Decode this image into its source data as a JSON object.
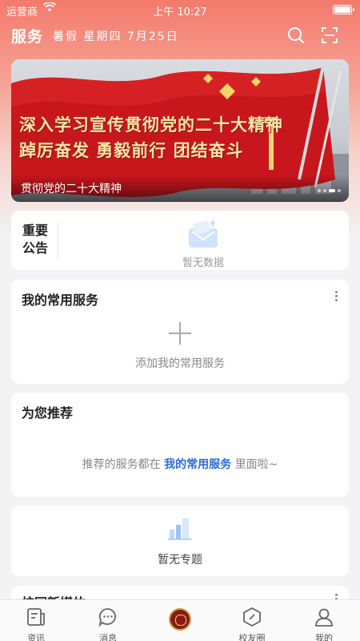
{
  "status_bar": {
    "carrier": "运营商",
    "time": "上午 10:27"
  },
  "header": {
    "title": "服务",
    "date": "暑假 星期四 7月25日"
  },
  "banner": {
    "headline_line1": "深入学习宣传贯彻党的二十大精神",
    "headline_line2": "踔厉奋发 勇毅前行 团结奋斗",
    "caption": "贯彻党的二十大精神"
  },
  "notice": {
    "label": "重要公告",
    "empty_text": "暂无数据"
  },
  "services": {
    "title": "我的常用服务",
    "add_text": "添加我的常用服务"
  },
  "recommend": {
    "title": "为您推荐",
    "hint_prefix": "推荐的服务都在 ",
    "hint_link": "我的常用服务",
    "hint_suffix": " 里面啦~"
  },
  "topics": {
    "empty_text": "暂无专题"
  },
  "next_section": {
    "title": "校园新媒体"
  },
  "tabbar": {
    "items": [
      {
        "label": "资讯",
        "icon": "news-icon"
      },
      {
        "label": "消息",
        "icon": "message-icon"
      },
      {
        "label": "",
        "icon": "emblem-icon"
      },
      {
        "label": "校友圈",
        "icon": "alumni-icon"
      },
      {
        "label": "我的",
        "icon": "profile-icon"
      }
    ]
  },
  "colors": {
    "accent_blue": "#2b6ae0",
    "banner_red": "#c8161d",
    "header_gradient": "#f47a6c"
  }
}
